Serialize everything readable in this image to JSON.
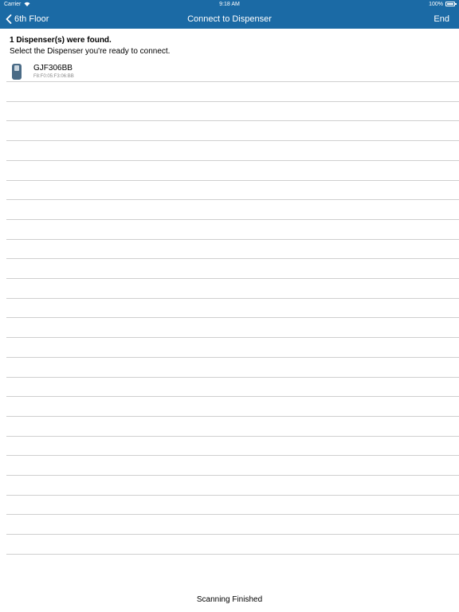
{
  "status_bar": {
    "carrier": "Carrier",
    "time": "9:18 AM",
    "battery": "100%"
  },
  "nav": {
    "back_label": "6th Floor",
    "title": "Connect to Dispenser",
    "end_label": "End"
  },
  "list_header": {
    "found_text": "1 Dispenser(s) were found.",
    "instruction": "Select the Dispenser you're ready to connect."
  },
  "devices": [
    {
      "name": "GJF306BB",
      "mac": "F8:F0:05:F3:06:BB",
      "icon": "dispenser-icon"
    }
  ],
  "footer": {
    "status": "Scanning Finished"
  },
  "colors": {
    "nav_bar": "#1b6aa5",
    "device_icon": "#4a6b86",
    "separator": "#cfcfcf"
  }
}
